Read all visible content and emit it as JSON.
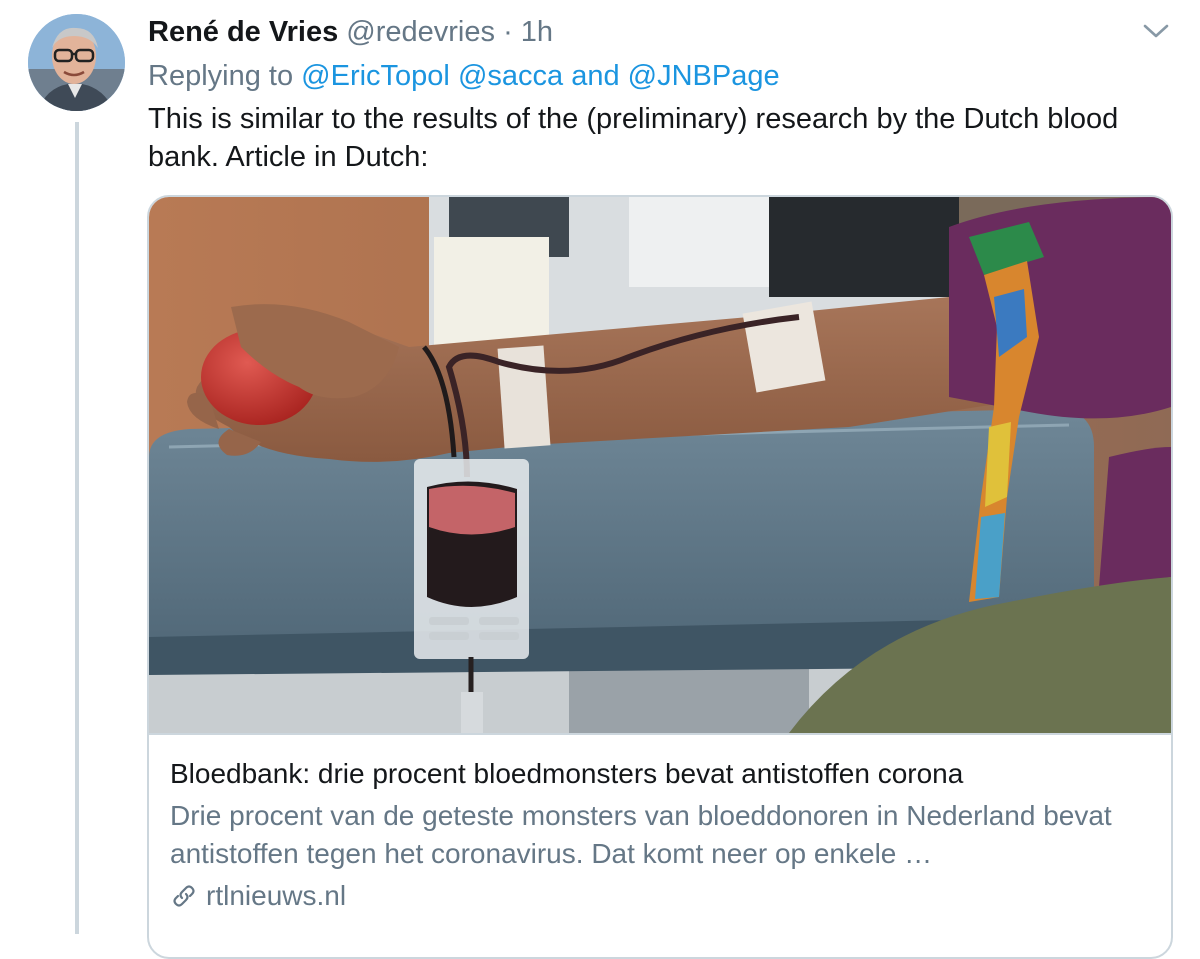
{
  "tweet": {
    "author_name": "René de Vries",
    "handle": "@redevries",
    "separator": "·",
    "time": "1h",
    "reply_prefix": "Replying to",
    "mentions": [
      "@EricTopol",
      "@sacca"
    ],
    "reply_and": "and",
    "last_mention": "@JNBPage",
    "text": "This is similar to the results of the (preliminary) research by the Dutch blood bank. Article in Dutch:"
  },
  "card": {
    "title": "Bloedbank: drie procent bloedmonsters bevat antistoffen corona",
    "description": "Drie procent van de geteste monsters van bloeddonoren in Nederland bevat antistoffen tegen het coronavirus. Dat komt neer op enkele …",
    "domain": "rtlnieuws.nl"
  },
  "icons": {
    "more": "chevron-down-icon",
    "link": "link-icon"
  },
  "colors": {
    "link_blue": "#1b95e0",
    "secondary_text": "#657786",
    "primary_text": "#14171a",
    "border": "#ccd6dd"
  }
}
